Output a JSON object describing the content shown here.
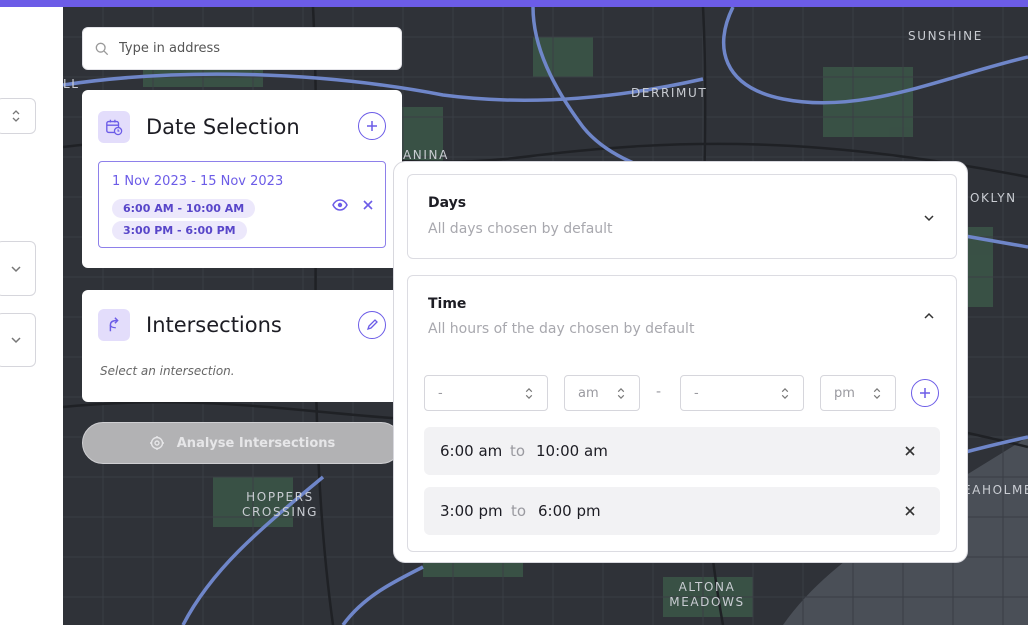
{
  "search": {
    "placeholder": "Type in address"
  },
  "date_selection": {
    "title": "Date Selection",
    "range": "1 Nov 2023 - 15 Nov 2023",
    "pills": [
      "6:00 AM - 10:00 AM",
      "3:00 PM - 6:00 PM"
    ]
  },
  "intersections": {
    "title": "Intersections",
    "hint": "Select an intersection."
  },
  "analyse": {
    "label": "Analyse Intersections"
  },
  "map_labels": {
    "sunshine": "SUNSHINE",
    "derrimut": "DERRIMUT",
    "anina": "ANINA",
    "ll": "LL",
    "oklyn": "OKLYN",
    "hoppers_1": "HOPPERS",
    "hoppers_2": "CROSSING",
    "eaholme": "EAHOLME",
    "altona_1": "ALTONA",
    "altona_2": "MEADOWS"
  },
  "days": {
    "title": "Days",
    "subtitle": "All days chosen by default"
  },
  "time": {
    "title": "Time",
    "subtitle": "All hours of the day chosen by default",
    "start_hour": "-",
    "start_period": "am",
    "separator": "-",
    "end_hour": "-",
    "end_period": "pm",
    "ranges": [
      {
        "from": "6:00 am",
        "to_word": "to",
        "to": "10:00 am"
      },
      {
        "from": "3:00 pm",
        "to_word": "to",
        "to": "6:00 pm"
      }
    ]
  },
  "colors": {
    "accent": "#6c5ce7",
    "map_bg": "#2f3238",
    "map_road": "#6f86c9",
    "map_park": "#3b5447"
  }
}
